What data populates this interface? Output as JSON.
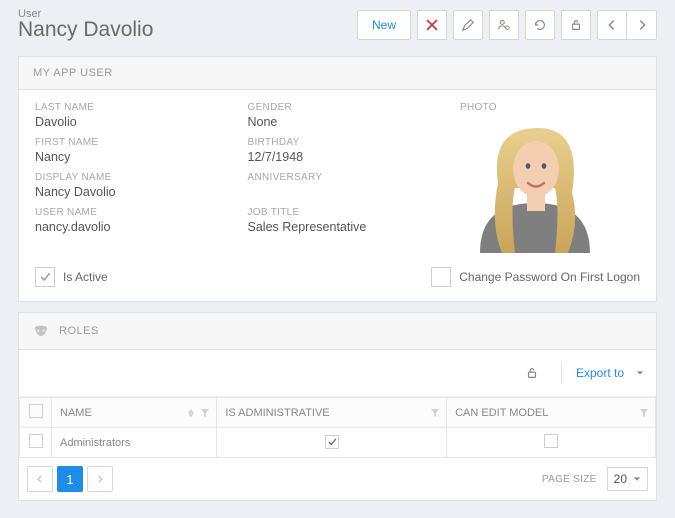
{
  "header": {
    "eyebrow": "User",
    "title": "Nancy Davolio",
    "new_label": "New"
  },
  "section_user": {
    "title": "MY APP USER",
    "labels": {
      "last_name": "LAST NAME",
      "first_name": "FIRST NAME",
      "display_name": "DISPLAY NAME",
      "user_name": "USER NAME",
      "gender": "GENDER",
      "birthday": "BIRTHDAY",
      "anniversary": "ANNIVERSARY",
      "job_title": "JOB TITLE",
      "photo": "PHOTO",
      "is_active": "Is Active",
      "change_pwd": "Change Password On First Logon"
    },
    "values": {
      "last_name": "Davolio",
      "first_name": "Nancy",
      "display_name": "Nancy Davolio",
      "user_name": "nancy.davolio",
      "gender": "None",
      "birthday": "12/7/1948",
      "anniversary": "",
      "job_title": "Sales Representative"
    },
    "is_active_checked": true,
    "change_pwd_checked": false
  },
  "section_roles": {
    "title": "ROLES",
    "export_label": "Export to",
    "columns": {
      "name": "NAME",
      "is_admin": "IS ADMINISTRATIVE",
      "can_edit": "CAN EDIT MODEL"
    },
    "rows": [
      {
        "name": "Administrators",
        "is_admin": true,
        "can_edit": false
      }
    ],
    "pager": {
      "current": "1",
      "page_size_label": "PAGE SIZE",
      "page_size_value": "20"
    }
  }
}
